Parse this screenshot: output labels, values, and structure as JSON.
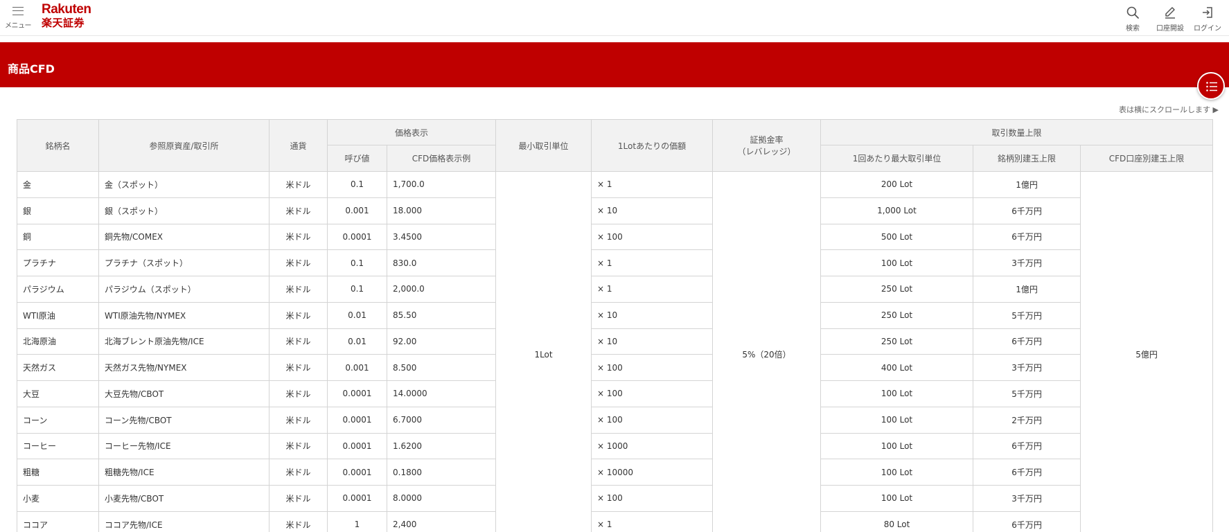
{
  "header": {
    "menu_label": "メニュー",
    "logo_en": "Rakuten",
    "logo_ja": "楽天証券",
    "actions": [
      {
        "label": "検索",
        "icon": "search-icon"
      },
      {
        "label": "口座開設",
        "icon": "pencil-icon"
      },
      {
        "label": "ログイン",
        "icon": "login-icon"
      }
    ]
  },
  "page": {
    "title": "商品CFD",
    "scroll_note": "表は横にスクロールします ▶"
  },
  "colors": {
    "brand_red": "#bf0000",
    "header_bg": "#f2f2f2",
    "border": "#d4d4d4"
  },
  "table": {
    "headers": {
      "name": "銘柄名",
      "reference": "参照原資産/取引所",
      "currency": "通貨",
      "price_display": "価格表示",
      "tick": "呼び値",
      "price_example": "CFD価格表示例",
      "min_unit": "最小取引単位",
      "lot_value": "1Lotあたりの価額",
      "margin_line1": "証拠金率",
      "margin_line2": "（レバレッジ）",
      "qty_limit": "取引数量上限",
      "max_per_trade": "1回あたり最大取引単位",
      "per_issue_limit": "銘柄別建玉上限",
      "account_limit": "CFD口座別建玉上限"
    },
    "merged": {
      "min_unit": "1Lot",
      "margin": "5%（20倍）",
      "account_limit": "5億円"
    },
    "rows": [
      {
        "name": "金",
        "ref": "金（スポット）",
        "cur": "米ドル",
        "tick": "0.1",
        "example": "1,700.0",
        "lot": "× 1",
        "max": "200 Lot",
        "limit": "1億円"
      },
      {
        "name": "銀",
        "ref": "銀（スポット）",
        "cur": "米ドル",
        "tick": "0.001",
        "example": "18.000",
        "lot": "× 10",
        "max": "1,000 Lot",
        "limit": "6千万円"
      },
      {
        "name": "銅",
        "ref": "銅先物/COMEX",
        "cur": "米ドル",
        "tick": "0.0001",
        "example": "3.4500",
        "lot": "× 100",
        "max": "500 Lot",
        "limit": "6千万円"
      },
      {
        "name": "プラチナ",
        "ref": "プラチナ（スポット）",
        "cur": "米ドル",
        "tick": "0.1",
        "example": "830.0",
        "lot": "× 1",
        "max": "100 Lot",
        "limit": "3千万円"
      },
      {
        "name": "パラジウム",
        "ref": "パラジウム（スポット）",
        "cur": "米ドル",
        "tick": "0.1",
        "example": "2,000.0",
        "lot": "× 1",
        "max": "250 Lot",
        "limit": "1億円"
      },
      {
        "name": "WTI原油",
        "ref": "WTI原油先物/NYMEX",
        "cur": "米ドル",
        "tick": "0.01",
        "example": "85.50",
        "lot": "× 10",
        "max": "250 Lot",
        "limit": "5千万円"
      },
      {
        "name": "北海原油",
        "ref": "北海ブレント原油先物/ICE",
        "cur": "米ドル",
        "tick": "0.01",
        "example": "92.00",
        "lot": "× 10",
        "max": "250 Lot",
        "limit": "6千万円"
      },
      {
        "name": "天然ガス",
        "ref": "天然ガス先物/NYMEX",
        "cur": "米ドル",
        "tick": "0.001",
        "example": "8.500",
        "lot": "× 100",
        "max": "400 Lot",
        "limit": "3千万円"
      },
      {
        "name": "大豆",
        "ref": "大豆先物/CBOT",
        "cur": "米ドル",
        "tick": "0.0001",
        "example": "14.0000",
        "lot": "× 100",
        "max": "100 Lot",
        "limit": "5千万円"
      },
      {
        "name": "コーン",
        "ref": "コーン先物/CBOT",
        "cur": "米ドル",
        "tick": "0.0001",
        "example": "6.7000",
        "lot": "× 100",
        "max": "100 Lot",
        "limit": "2千万円"
      },
      {
        "name": "コーヒー",
        "ref": "コーヒー先物/ICE",
        "cur": "米ドル",
        "tick": "0.0001",
        "example": "1.6200",
        "lot": "× 1000",
        "max": "100 Lot",
        "limit": "6千万円"
      },
      {
        "name": "粗糖",
        "ref": "粗糖先物/ICE",
        "cur": "米ドル",
        "tick": "0.0001",
        "example": "0.1800",
        "lot": "× 10000",
        "max": "100 Lot",
        "limit": "6千万円"
      },
      {
        "name": "小麦",
        "ref": "小麦先物/CBOT",
        "cur": "米ドル",
        "tick": "0.0001",
        "example": "8.0000",
        "lot": "× 100",
        "max": "100 Lot",
        "limit": "3千万円"
      },
      {
        "name": "ココア",
        "ref": "ココア先物/ICE",
        "cur": "米ドル",
        "tick": "1",
        "example": "2,400",
        "lot": "× 1",
        "max": "80 Lot",
        "limit": "6千万円"
      }
    ]
  }
}
